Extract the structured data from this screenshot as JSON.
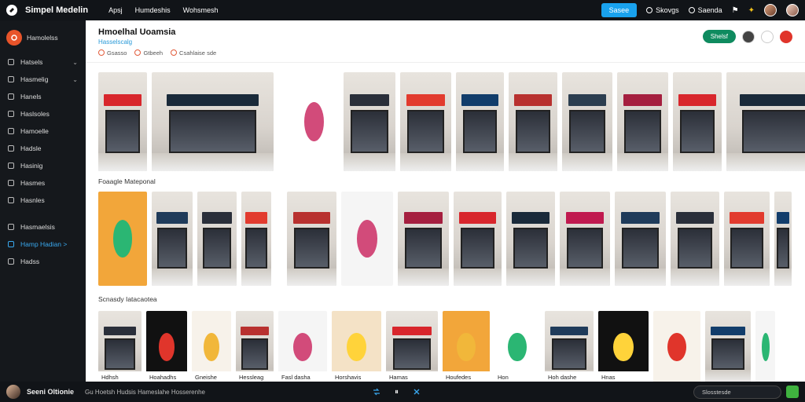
{
  "app": {
    "name": "Simpel Medelin"
  },
  "topnav": [
    "Apsj",
    "Humdeshis",
    "Wohsmesh"
  ],
  "topright": {
    "primary": "Sasee",
    "item1": "Skovgs",
    "item2": "Saenda"
  },
  "sidebar": {
    "header": "Hamolelss",
    "items": [
      {
        "label": "Hatsels",
        "chev": "⌄",
        "icon": "home-icon"
      },
      {
        "label": "Hasmelig",
        "chev": "⌄",
        "icon": "grid-icon"
      },
      {
        "label": "Hanels",
        "icon": "list-icon"
      },
      {
        "label": "Haslsoles",
        "icon": "file-icon"
      },
      {
        "label": "Hamoelle",
        "icon": "folder-icon"
      },
      {
        "label": "Hadsle",
        "icon": "clock-icon"
      },
      {
        "label": "Hasinig",
        "icon": "star-icon"
      },
      {
        "label": "Hasmes",
        "icon": "tag-icon"
      },
      {
        "label": "Hasnles",
        "icon": "user-icon"
      }
    ],
    "items2": [
      {
        "label": "Hasmaelsis",
        "icon": "shield-icon"
      },
      {
        "label": "Hamp Hadian >",
        "icon": "shuffle-icon",
        "active": true
      },
      {
        "label": "Hadss",
        "icon": "settings-icon"
      }
    ]
  },
  "page": {
    "title": "Hmoelhal Uoamsia",
    "subtitle": "Hasselscalg",
    "meta": [
      "Gsasso",
      "Gtbeeh",
      "Csahlaise sde"
    ],
    "action": "Shelsf"
  },
  "sections": [
    "Foaagle Mateponal",
    "Scnasdy Iatacaotea"
  ],
  "row3_labels": [
    "Hdhsh",
    "Hoahadhs",
    "Gneishe",
    "Hessleag",
    "Fasl dasha",
    "Horshavis",
    "Hamas",
    "Houfedes",
    "Hon",
    "Hoh dashe",
    "Hnas"
  ],
  "bottom": {
    "name": "Seeni Oltionie",
    "status": "Gu Hoetsh Hudsis Hameslahe Hosserenhe",
    "chat_placeholder": "Slosstesde"
  },
  "colors": {
    "accent": "#19a2ee",
    "brand_red": "#e0352b",
    "green": "#0f8b5f"
  }
}
